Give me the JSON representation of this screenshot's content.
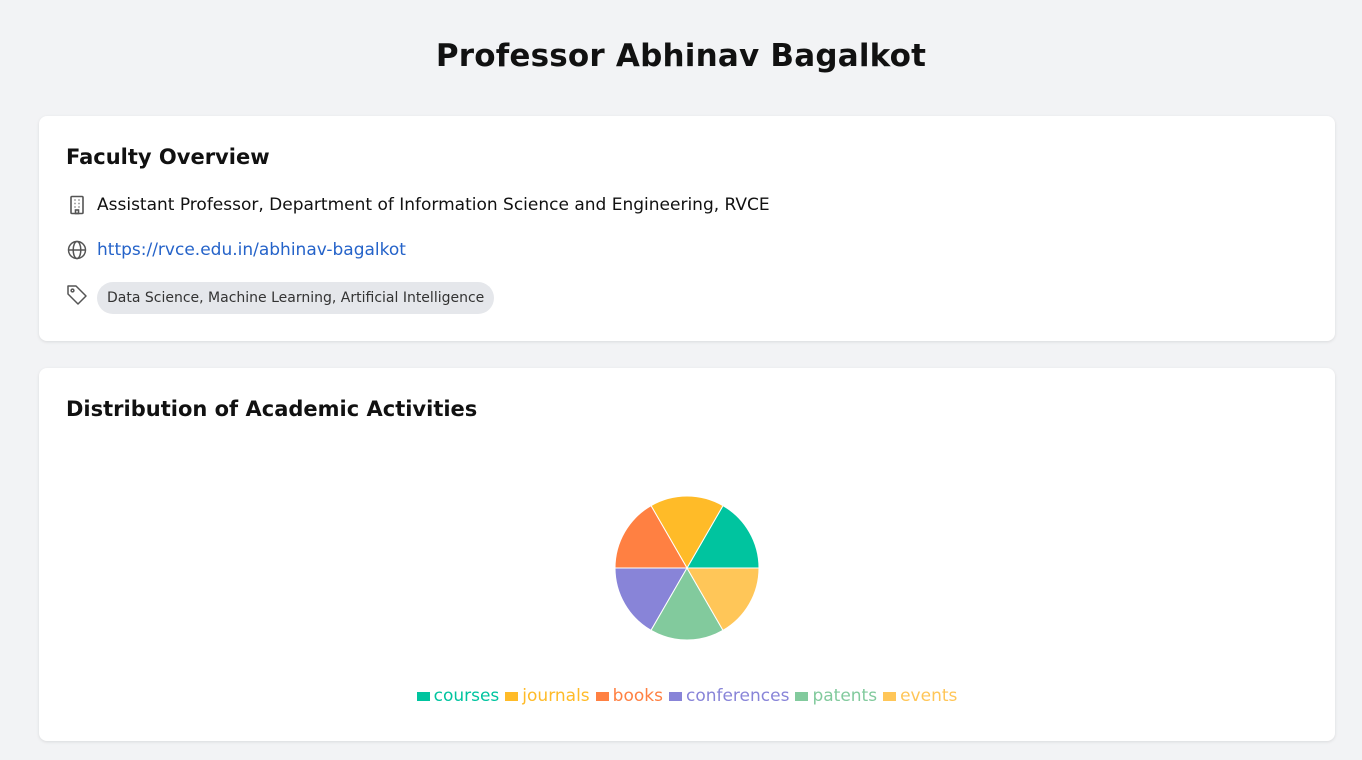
{
  "page": {
    "title": "Professor Abhinav Bagalkot"
  },
  "overview": {
    "heading": "Faculty Overview",
    "position": "Assistant Professor, Department of Information Science and Engineering, RVCE",
    "website": "https://rvce.edu.in/abhinav-bagalkot",
    "tags": "Data Science, Machine Learning, Artificial Intelligence",
    "icons": {
      "position": "building-icon",
      "website": "globe-icon",
      "tags": "tag-icon"
    }
  },
  "chart": {
    "heading": "Distribution of Academic Activities"
  },
  "chart_data": {
    "type": "pie",
    "title": "Distribution of Academic Activities",
    "categories": [
      "courses",
      "journals",
      "books",
      "conferences",
      "patents",
      "events"
    ],
    "values": [
      1,
      1,
      1,
      1,
      1,
      1
    ],
    "colors": [
      "#00c49f",
      "#ffbb28",
      "#ff8042",
      "#8884d8",
      "#82ca9d",
      "#ffc658"
    ],
    "legend_position": "bottom"
  }
}
